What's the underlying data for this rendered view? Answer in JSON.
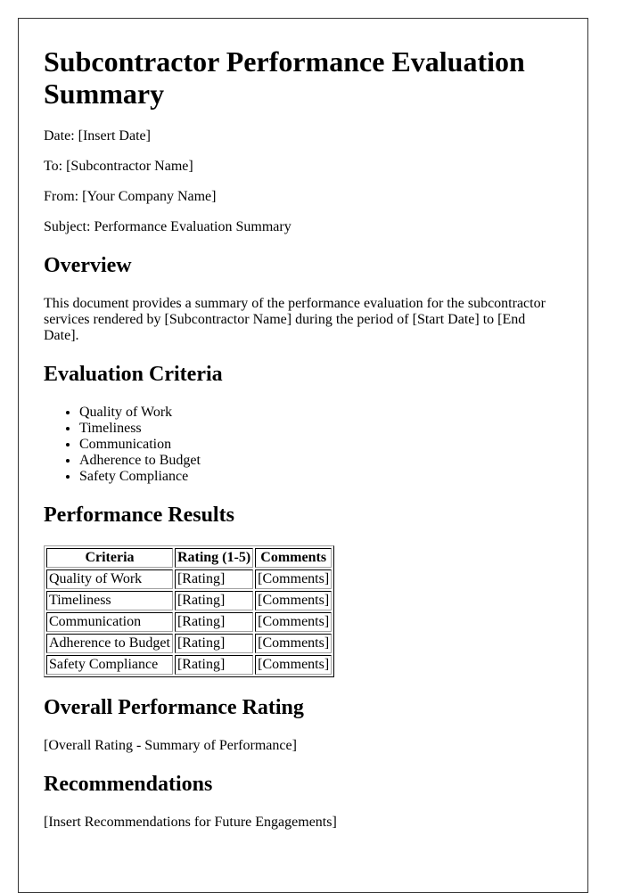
{
  "document": {
    "title": "Subcontractor Performance Evaluation Summary",
    "meta": {
      "date": "Date: [Insert Date]",
      "to": "To: [Subcontractor Name]",
      "from": "From: [Your Company Name]",
      "subject": "Subject: Performance Evaluation Summary"
    },
    "overview": {
      "heading": "Overview",
      "text": "This document provides a summary of the performance evaluation for the subcontractor services rendered by [Subcontractor Name] during the period of [Start Date] to [End Date]."
    },
    "criteria": {
      "heading": "Evaluation Criteria",
      "items": [
        "Quality of Work",
        "Timeliness",
        "Communication",
        "Adherence to Budget",
        "Safety Compliance"
      ]
    },
    "results": {
      "heading": "Performance Results",
      "columns": [
        "Criteria",
        "Rating (1-5)",
        "Comments"
      ],
      "rows": [
        [
          "Quality of Work",
          "[Rating]",
          "[Comments]"
        ],
        [
          "Timeliness",
          "[Rating]",
          "[Comments]"
        ],
        [
          "Communication",
          "[Rating]",
          "[Comments]"
        ],
        [
          "Adherence to Budget",
          "[Rating]",
          "[Comments]"
        ],
        [
          "Safety Compliance",
          "[Rating]",
          "[Comments]"
        ]
      ]
    },
    "overall": {
      "heading": "Overall Performance Rating",
      "text": "[Overall Rating - Summary of Performance]"
    },
    "recommendations": {
      "heading": "Recommendations",
      "text": "[Insert Recommendations for Future Engagements]"
    }
  }
}
